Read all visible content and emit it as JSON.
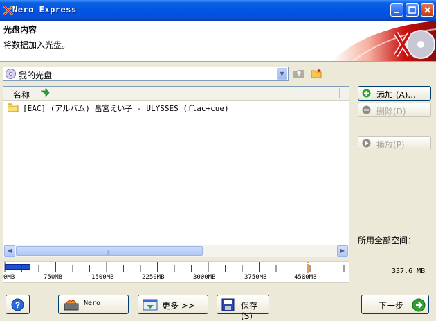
{
  "window": {
    "title": "Nero Express"
  },
  "header": {
    "title": "光盘内容",
    "subtitle": "将数据加入光盘。"
  },
  "disc_selector": {
    "value": "我的光盘"
  },
  "file_list": {
    "column_name": "名称",
    "rows": [
      {
        "name": "[EAC] (アルバム) 畠宮えい子 - ULYSSES (flac+cue)"
      }
    ]
  },
  "side_buttons": {
    "add": "添加 (A)...",
    "delete": "删除(D)",
    "play": "播放(P)"
  },
  "space": {
    "label": "所用全部空间：",
    "value": "337.6 MB",
    "used_fraction": 0.075
  },
  "ruler": {
    "labels": [
      "0MB",
      "750MB",
      "1500MB",
      "2250MB",
      "3000MB",
      "3750MB",
      "4500MB"
    ]
  },
  "bottom": {
    "nero": "Nero",
    "more": "更多 >>",
    "save": "保存(S)",
    "next": "下一步"
  },
  "colors": {
    "title_bar": "#0054e3",
    "used_bar": "#1d4fd6",
    "background": "#ece9d8"
  }
}
